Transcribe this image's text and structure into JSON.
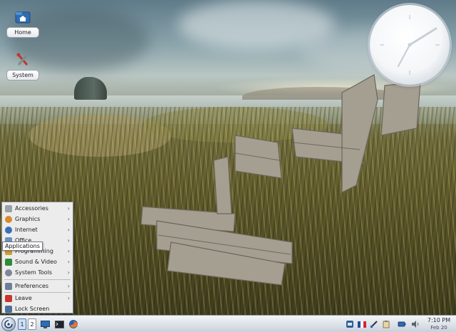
{
  "desktop": {
    "icons": [
      {
        "label": "Home",
        "icon": "home-folder-icon"
      },
      {
        "label": "System",
        "icon": "system-tools-icon"
      }
    ],
    "widget": {
      "name": "analog-clock",
      "time": "7:10"
    }
  },
  "menu": {
    "tooltip": "Applications",
    "items": [
      {
        "label": "Accessories",
        "icon": "accessories-icon",
        "color": "#8a8a8a",
        "submenu": true
      },
      {
        "label": "Graphics",
        "icon": "graphics-icon",
        "color": "#d88a2c",
        "submenu": true
      },
      {
        "label": "Internet",
        "icon": "internet-icon",
        "color": "#3a6fb8",
        "submenu": true
      },
      {
        "label": "Office",
        "icon": "office-icon",
        "color": "#6c8fc0",
        "submenu": true
      },
      {
        "label": "Programming",
        "icon": "programming-icon",
        "color": "#d0a030",
        "submenu": true
      },
      {
        "label": "Sound & Video",
        "icon": "sound-video-icon",
        "color": "#2f8a3a",
        "submenu": true
      },
      {
        "label": "System Tools",
        "icon": "system-tools-icon",
        "color": "#7e8794",
        "submenu": true
      },
      {
        "label": "Preferences",
        "icon": "preferences-icon",
        "color": "#6d7f95",
        "submenu": true
      },
      {
        "label": "Leave",
        "icon": "leave-icon",
        "color": "#c8362f",
        "submenu": true
      },
      {
        "label": "Lock Screen",
        "icon": "lock-screen-icon",
        "color": "#4e6f9a",
        "submenu": false
      }
    ]
  },
  "taskbar": {
    "launcher_icon": "applications-launcher-icon",
    "desktops": [
      "1",
      "2"
    ],
    "active_desktop": "1",
    "quick_launch": [
      {
        "icon": "show-desktop-icon"
      },
      {
        "icon": "terminal-icon"
      },
      {
        "icon": "firefox-icon"
      }
    ],
    "tray": [
      {
        "icon": "keyboard-icon"
      },
      {
        "icon": "french-flag-icon"
      },
      {
        "icon": "paint-brush-icon"
      },
      {
        "icon": "clipboard-icon"
      },
      {
        "icon": "battery-icon"
      },
      {
        "icon": "volume-icon"
      }
    ],
    "clock": {
      "time": "7:10 PM",
      "date": "Feb 20"
    }
  }
}
